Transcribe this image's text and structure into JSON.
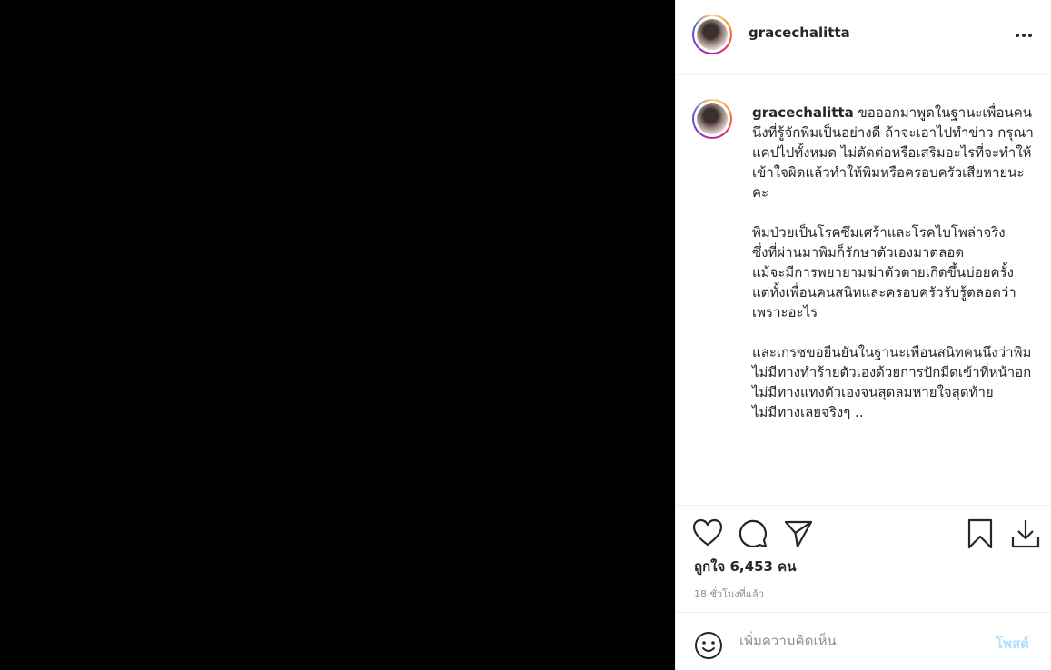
{
  "post": {
    "username": "gracechalitta",
    "more_icon": "more-horizontal-icon"
  },
  "caption": {
    "username": "gracechalitta",
    "text": " ขอออกมาพูดในฐานะเพื่อนคนนึงที่รู้จักพิมเป็นอย่างดี ถ้าจะเอาไปทำข่าว กรุณาแคปไปทั้งหมด ไม่ตัดต่อหรือเสริมอะไรที่จะทำให้เข้าใจผิดแล้วทำให้พิมหรือครอบครัวเสียหายนะคะ\n\nพิมป่วยเป็นโรคซึมเศร้าและโรคไบโพล่าจริง\nซึ่งที่ผ่านมาพิมก็รักษาตัวเองมาตลอด\nแม้จะมีการพยายามฆ่าตัวตายเกิดขึ้นบ่อยครั้ง\nแต่ทั้งเพื่อนคนสนิทและครอบครัวรับรู้ตลอดว่าเพราะอะไร\n\nและเกรซขอยืนยันในฐานะเพื่อนสนิทคนนึงว่าพิมไม่มีทางทำร้ายตัวเองด้วยการปักมีดเข้าที่หน้าอก\nไม่มีทางแทงตัวเองจนสุดลมหายใจสุดท้าย\nไม่มีทางเลยจริงๆ .."
  },
  "actions": {
    "icons": [
      "heart-icon",
      "comment-icon",
      "share-icon",
      "bookmark-icon",
      "download-icon"
    ]
  },
  "likes_text": "ถูกใจ 6,453 คน",
  "timestamp": "18 ชั่วโมงที่แล้ว",
  "comment": {
    "emoji_icon": "emoji-icon",
    "placeholder": "เพิ่มความคิดเห็น",
    "value": "",
    "post_label": "โพสต์"
  },
  "colors": {
    "media_background": "#000000",
    "text": "#262626",
    "muted": "#8e8e8e",
    "post_button_disabled": "#b2dffc",
    "divider": "#efefef"
  }
}
